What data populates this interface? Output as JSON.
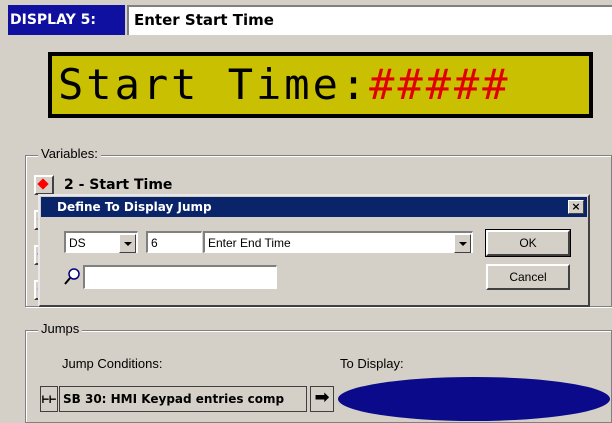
{
  "header": {
    "label": "DISPLAY 5:",
    "name": "Enter Start Time"
  },
  "lcd": {
    "text": "Start Time:",
    "value": "#####"
  },
  "variables": {
    "title": "Variables:",
    "items": [
      {
        "label": "2 - Start Time",
        "color": "#ff0000"
      },
      {
        "label": "",
        "color": "#00cc00"
      },
      {
        "label": "",
        "color": "#0000ff"
      },
      {
        "label": "",
        "color": "#ff00ff"
      }
    ]
  },
  "dialog": {
    "title": "Define To Display Jump",
    "close_label": "×",
    "type_value": "DS",
    "number_value": "6",
    "display_value": "Enter End Time",
    "search_value": "",
    "ok_label": "OK",
    "cancel_label": "Cancel"
  },
  "jumps": {
    "title": "Jumps",
    "conditions_label": "Jump Conditions:",
    "to_display_label": "To Display:",
    "condition_icon": "⊢⊢",
    "condition_text": "SB  30: HMI Keypad entries comp",
    "arrow": "➡"
  },
  "colors": {
    "header_bg": "#1010a0",
    "lcd_bg": "#c8c000",
    "lcd_value": "#e00000",
    "dialog_title_bg": "#0a246a",
    "jump_target": "#0a0a8a"
  }
}
